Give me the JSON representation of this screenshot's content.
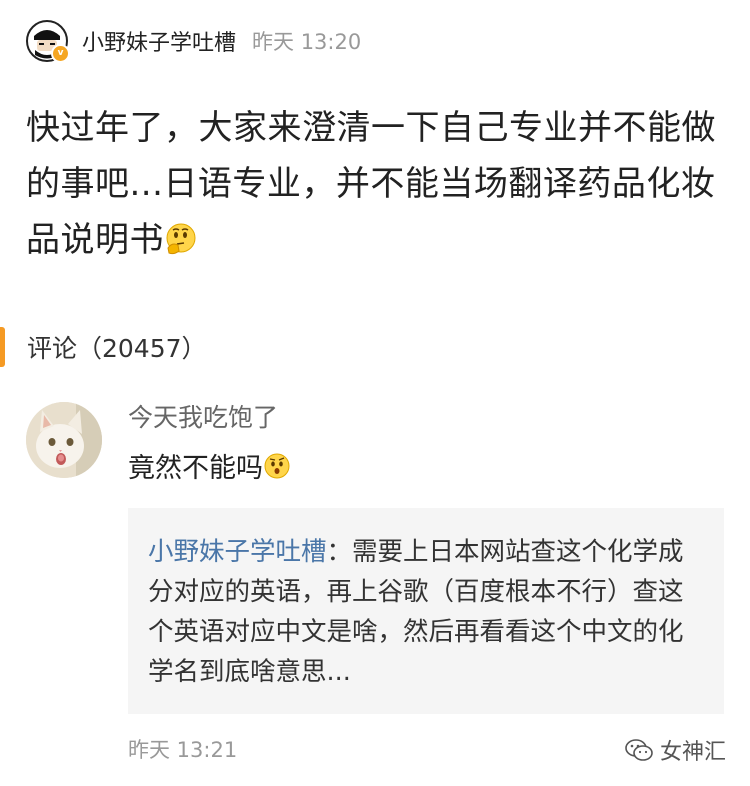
{
  "post": {
    "author": "小野妹子学吐槽",
    "time": "昨天 13:20",
    "verified_badge": "v",
    "text": "快过年了，大家来澄清一下自己专业并不能做的事吧...日语专业，并不能当场翻译药品化妆品说明书"
  },
  "comments": {
    "label": "评论（20457）",
    "accent_color": "#f59a23"
  },
  "comment": {
    "user": "今天我吃饱了",
    "text": "竟然不能吗",
    "reply_author": "小野妹子学吐槽",
    "reply_separator": "：",
    "reply_text": "需要上日本网站查这个化学成分对应的英语，再上谷歌（百度根本不行）查这个英语对应中文是啥，然后再看看这个中文的化学名到底啥意思...",
    "time": "昨天 13:21"
  },
  "watermark": {
    "text": "女神汇"
  },
  "icons": {
    "post_emoji": "thinking-face-icon",
    "comment_emoji": "surprised-face-icon",
    "watermark_icon": "wechat-icon"
  }
}
